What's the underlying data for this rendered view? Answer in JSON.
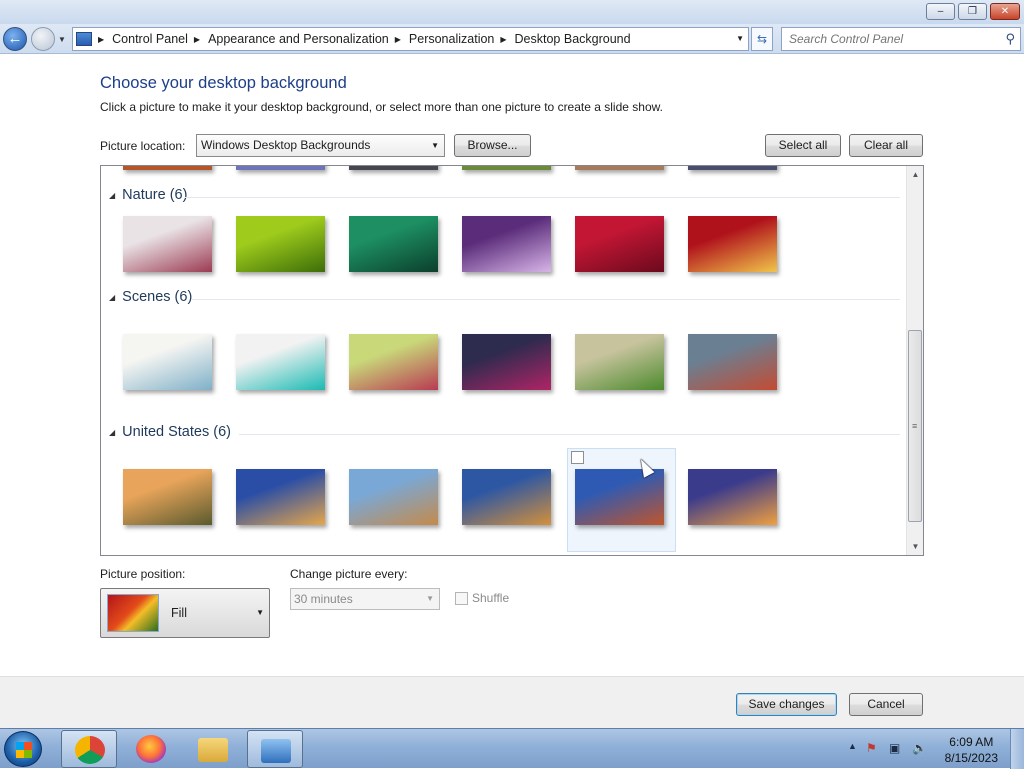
{
  "window": {
    "caption_buttons": {
      "minimize": "–",
      "restore": "❐",
      "close": "✕"
    }
  },
  "address_bar": {
    "breadcrumbs": [
      "Control Panel",
      "Appearance and Personalization",
      "Personalization",
      "Desktop Background"
    ],
    "search_placeholder": "Search Control Panel"
  },
  "page": {
    "title": "Choose your desktop background",
    "subtitle": "Click a picture to make it your desktop background, or select more than one picture to create a slide show.",
    "picture_location_label": "Picture location:",
    "picture_location_value": "Windows Desktop Backgrounds",
    "browse_label": "Browse...",
    "select_all_label": "Select all",
    "clear_all_label": "Clear all"
  },
  "gallery": {
    "groups": [
      {
        "name": "Nature (6)",
        "thumb_colors": [
          [
            "#e9e3e6",
            "#9b3b52"
          ],
          [
            "#9fcc1c",
            "#3d6e08"
          ],
          [
            "#1d8f63",
            "#0b3f2c"
          ],
          [
            "#5b2c7a",
            "#d7b5e8"
          ],
          [
            "#c21634",
            "#6b0a1d"
          ],
          [
            "#b0121c",
            "#f1c54a"
          ]
        ]
      },
      {
        "name": "Scenes (6)",
        "thumb_colors": [
          [
            "#f5f5f2",
            "#7fb0c8"
          ],
          [
            "#f2f2f2",
            "#1bbab3"
          ],
          [
            "#c9d97a",
            "#b83a52"
          ],
          [
            "#2d2b4e",
            "#b02466"
          ],
          [
            "#c7c39d",
            "#4c8a2d"
          ],
          [
            "#6b7f92",
            "#c44b32"
          ]
        ]
      },
      {
        "name": "United States (6)",
        "thumb_colors": [
          [
            "#e7a45a",
            "#5a5a2e"
          ],
          [
            "#2a4ea6",
            "#e6a64b"
          ],
          [
            "#7aa8d6",
            "#c48a4b"
          ],
          [
            "#2e57a3",
            "#d4903b"
          ],
          [
            "#2f5ab3",
            "#c0552c"
          ],
          [
            "#3b3b8c",
            "#f0a040"
          ]
        ]
      }
    ]
  },
  "settings": {
    "picture_position_label": "Picture position:",
    "picture_position_value": "Fill",
    "change_every_label": "Change picture every:",
    "change_every_value": "30 minutes",
    "shuffle_label": "Shuffle"
  },
  "footer": {
    "save_label": "Save changes",
    "cancel_label": "Cancel"
  },
  "taskbar": {
    "pinned": [
      "chrome-icon",
      "firefox-icon",
      "file-explorer-icon",
      "control-panel-icon"
    ],
    "clock_time": "6:09 AM",
    "clock_date": "8/15/2023"
  },
  "colors": {
    "title_blue": "#1d3e89",
    "group_header": "#1e395b",
    "selection_bg": "#eef5fd"
  }
}
